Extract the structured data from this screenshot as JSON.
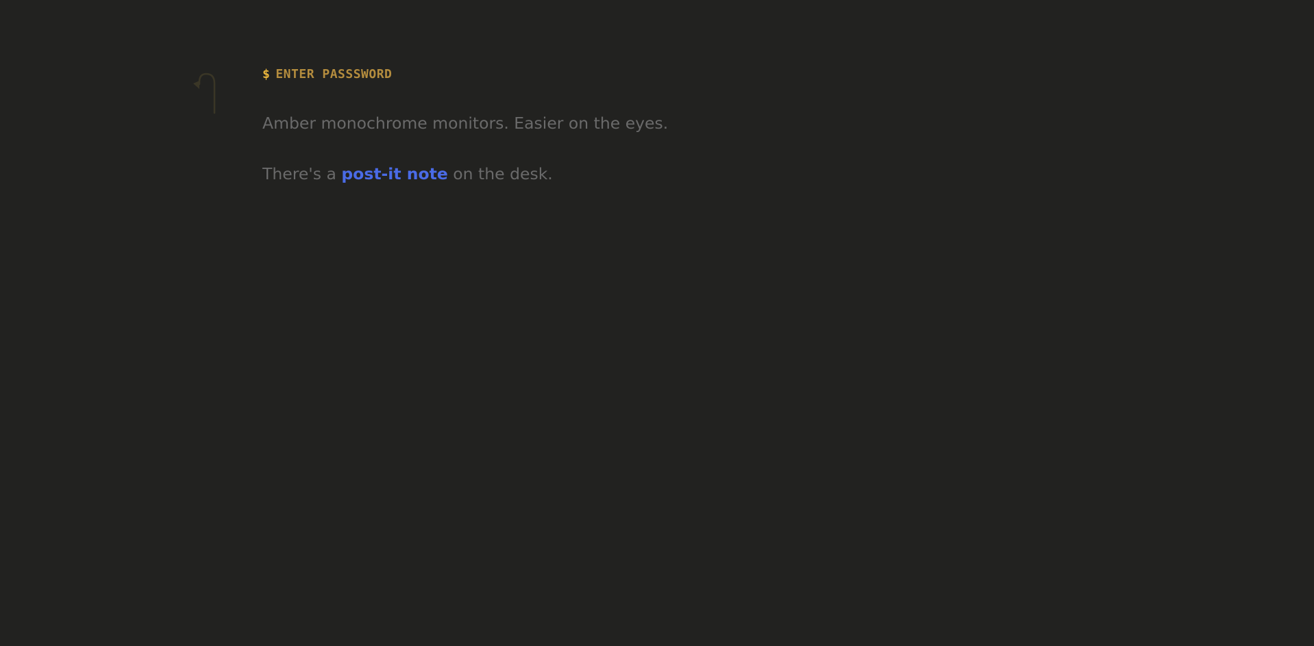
{
  "theme": {
    "background": "#222220",
    "amber": "#b58d3e",
    "amber_bright": "#e9b53c",
    "text_muted": "#6a6a6a",
    "link": "#4a6be6",
    "back_icon_color": "#3a3626"
  },
  "nav": {
    "back_icon": "return-arrow-icon"
  },
  "prompt": {
    "symbol": "$",
    "text": "ENTER PASSSWORD"
  },
  "story": {
    "paragraph_1": "Amber monochrome monitors. Easier on the eyes.",
    "paragraph_2": {
      "before": "There's a ",
      "link": "post-it note",
      "after": " on the desk."
    }
  }
}
